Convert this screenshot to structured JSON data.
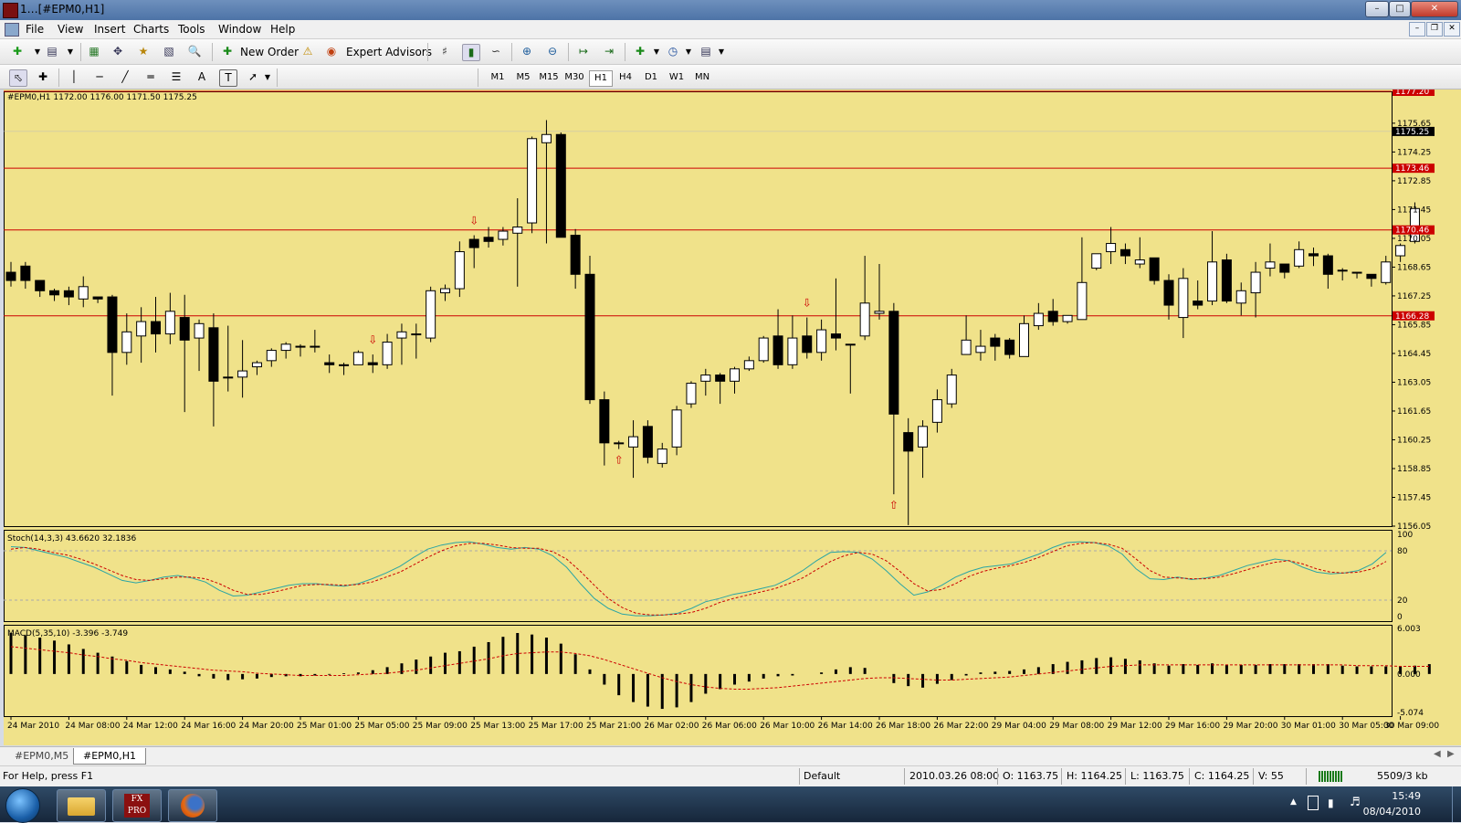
{
  "window": {
    "title": "1…[#EPM0,H1]",
    "btn_min": "–",
    "btn_max": "□",
    "btn_close": "✕"
  },
  "menu": {
    "items": [
      "File",
      "View",
      "Insert",
      "Charts",
      "Tools",
      "Window",
      "Help"
    ]
  },
  "toolbar": {
    "new_order": "New Order",
    "expert_advisors": "Expert Advisors"
  },
  "timeframes": {
    "items": [
      "M1",
      "M5",
      "M15",
      "M30",
      "H1",
      "H4",
      "D1",
      "W1",
      "MN"
    ],
    "active": "H1"
  },
  "chart_info": "#EPM0,H1  1172.00 1176.00 1171.50 1175.25",
  "stoch_label": "Stoch(14,3,3) 43.6620 32.1836",
  "macd_label": "MACD(5,35,10) -3.396 -3.749",
  "tabs": [
    "#EPM0,M5",
    "#EPM0,H1"
  ],
  "status": {
    "help": "For Help, press F1",
    "profile": "Default",
    "datetime": "2010.03.26 08:00",
    "open": "O: 1163.75",
    "high": "H: 1164.25",
    "low": "L: 1163.75",
    "close": "C: 1164.25",
    "volume": "V: 55",
    "traffic": "5509/3 kb"
  },
  "taskbar": {
    "time": "15:49",
    "date": "08/04/2010"
  },
  "colors": {
    "chart_bg": "#f0e28a",
    "level_line": "#cc0000",
    "stoch_main": "#2aa5a5",
    "stoch_signal": "#cc0000",
    "macd_signal": "#cc0000",
    "price_tag": "#000000",
    "level_tag": "#cc0000"
  },
  "chart_data": [
    {
      "type": "candlestick",
      "symbol": "#EPM0,H1",
      "ylim": [
        1156.05,
        1177.2
      ],
      "y_ticks": [
        1156.05,
        1157.45,
        1158.85,
        1160.25,
        1161.65,
        1163.05,
        1164.45,
        1165.85,
        1167.25,
        1168.65,
        1170.05,
        1171.45,
        1172.85,
        1174.25,
        1175.65
      ],
      "price_tag": 1175.25,
      "levels": [
        1177.2,
        1173.46,
        1170.46,
        1166.28
      ],
      "x_labels": [
        "24 Mar 2010",
        "24 Mar 08:00",
        "24 Mar 12:00",
        "24 Mar 16:00",
        "24 Mar 20:00",
        "25 Mar 01:00",
        "25 Mar 05:00",
        "25 Mar 09:00",
        "25 Mar 13:00",
        "25 Mar 17:00",
        "25 Mar 21:00",
        "26 Mar 02:00",
        "26 Mar 06:00",
        "26 Mar 10:00",
        "26 Mar 14:00",
        "26 Mar 18:00",
        "26 Mar 22:00",
        "29 Mar 04:00",
        "29 Mar 08:00",
        "29 Mar 12:00",
        "29 Mar 16:00",
        "29 Mar 20:00",
        "30 Mar 01:00",
        "30 Mar 05:00",
        "30 Mar 09:00"
      ],
      "fractal_up_markers": [
        25,
        32,
        55
      ],
      "fractal_down_markers": [
        42,
        61
      ],
      "ohlc": [
        [
          1168.4,
          1168.9,
          1167.7,
          1168.0
        ],
        [
          1168.7,
          1168.9,
          1167.6,
          1168.0
        ],
        [
          1168.0,
          1168.0,
          1167.2,
          1167.5
        ],
        [
          1167.5,
          1167.6,
          1167.0,
          1167.3
        ],
        [
          1167.5,
          1167.7,
          1166.8,
          1167.2
        ],
        [
          1167.1,
          1168.2,
          1166.7,
          1167.7
        ],
        [
          1167.2,
          1167.2,
          1166.9,
          1167.1
        ],
        [
          1167.2,
          1167.3,
          1162.4,
          1164.5
        ],
        [
          1164.5,
          1166.4,
          1163.9,
          1165.5
        ],
        [
          1165.3,
          1166.7,
          1164.0,
          1166.0
        ],
        [
          1166.0,
          1167.2,
          1164.5,
          1165.4
        ],
        [
          1165.4,
          1167.4,
          1164.9,
          1166.5
        ],
        [
          1166.2,
          1167.3,
          1161.6,
          1165.1
        ],
        [
          1165.2,
          1166.1,
          1163.6,
          1165.9
        ],
        [
          1165.7,
          1166.4,
          1160.9,
          1163.1
        ],
        [
          1163.3,
          1165.8,
          1162.6,
          1163.3
        ],
        [
          1163.3,
          1165.1,
          1162.3,
          1163.6
        ],
        [
          1163.8,
          1164.1,
          1163.4,
          1164.0
        ],
        [
          1164.1,
          1164.7,
          1163.8,
          1164.6
        ],
        [
          1164.6,
          1165.0,
          1164.2,
          1164.9
        ],
        [
          1164.8,
          1164.9,
          1164.3,
          1164.8
        ],
        [
          1164.8,
          1165.6,
          1164.5,
          1164.8
        ],
        [
          1164.0,
          1164.4,
          1163.5,
          1163.9
        ],
        [
          1163.9,
          1164.0,
          1163.4,
          1163.9
        ],
        [
          1163.9,
          1164.6,
          1163.9,
          1164.5
        ],
        [
          1164.0,
          1164.4,
          1163.5,
          1163.9
        ],
        [
          1163.9,
          1165.4,
          1163.7,
          1165.0
        ],
        [
          1165.2,
          1165.9,
          1163.9,
          1165.5
        ],
        [
          1165.4,
          1165.9,
          1164.2,
          1165.4
        ],
        [
          1165.2,
          1167.7,
          1165.0,
          1167.5
        ],
        [
          1167.4,
          1167.8,
          1167.0,
          1167.6
        ],
        [
          1167.6,
          1169.9,
          1167.2,
          1169.4
        ],
        [
          1170.0,
          1170.2,
          1168.6,
          1169.6
        ],
        [
          1170.1,
          1170.6,
          1169.6,
          1169.9
        ],
        [
          1170.0,
          1170.6,
          1169.7,
          1170.4
        ],
        [
          1170.3,
          1172.0,
          1167.7,
          1170.6
        ],
        [
          1170.8,
          1175.0,
          1170.3,
          1174.9
        ],
        [
          1174.7,
          1175.8,
          1169.8,
          1175.1
        ],
        [
          1175.1,
          1175.2,
          1170.1,
          1170.1
        ],
        [
          1170.2,
          1170.5,
          1167.6,
          1168.3
        ],
        [
          1168.3,
          1169.2,
          1162.0,
          1162.2
        ],
        [
          1162.2,
          1162.6,
          1159.0,
          1160.1
        ],
        [
          1160.1,
          1160.2,
          1159.8,
          1160.1
        ],
        [
          1159.9,
          1161.2,
          1158.4,
          1160.4
        ],
        [
          1160.9,
          1161.2,
          1159.1,
          1159.4
        ],
        [
          1159.1,
          1160.1,
          1158.9,
          1159.8
        ],
        [
          1159.9,
          1161.9,
          1159.5,
          1161.7
        ],
        [
          1162.0,
          1163.1,
          1161.8,
          1163.0
        ],
        [
          1163.1,
          1163.7,
          1162.4,
          1163.4
        ],
        [
          1163.4,
          1163.5,
          1162.0,
          1163.1
        ],
        [
          1163.1,
          1163.8,
          1162.5,
          1163.7
        ],
        [
          1163.7,
          1164.3,
          1163.6,
          1164.1
        ],
        [
          1164.1,
          1165.3,
          1164.0,
          1165.2
        ],
        [
          1165.3,
          1166.6,
          1163.7,
          1163.9
        ],
        [
          1163.9,
          1166.3,
          1163.7,
          1165.2
        ],
        [
          1165.3,
          1166.2,
          1164.2,
          1164.5
        ],
        [
          1164.5,
          1166.1,
          1164.1,
          1165.6
        ],
        [
          1165.4,
          1168.1,
          1164.6,
          1165.2
        ],
        [
          1164.9,
          1164.9,
          1162.5,
          1164.9
        ],
        [
          1165.3,
          1169.2,
          1165.1,
          1166.9
        ],
        [
          1166.4,
          1168.8,
          1166.1,
          1166.5
        ],
        [
          1166.5,
          1166.9,
          1157.6,
          1161.5
        ],
        [
          1160.6,
          1161.3,
          1156.1,
          1159.7
        ],
        [
          1159.9,
          1161.2,
          1158.4,
          1160.9
        ],
        [
          1161.1,
          1162.7,
          1160.6,
          1162.2
        ],
        [
          1162.0,
          1163.7,
          1161.8,
          1163.4
        ],
        [
          1164.4,
          1166.3,
          1164.4,
          1165.1
        ],
        [
          1164.5,
          1165.6,
          1164.1,
          1164.8
        ],
        [
          1165.2,
          1165.4,
          1164.1,
          1164.8
        ],
        [
          1165.1,
          1165.2,
          1164.2,
          1164.4
        ],
        [
          1164.3,
          1166.3,
          1164.3,
          1165.9
        ],
        [
          1165.8,
          1166.9,
          1165.6,
          1166.4
        ],
        [
          1166.5,
          1167.1,
          1165.8,
          1166.0
        ],
        [
          1166.0,
          1166.3,
          1165.9,
          1166.3
        ],
        [
          1166.1,
          1170.1,
          1166.1,
          1167.9
        ],
        [
          1168.6,
          1169.3,
          1168.5,
          1169.3
        ],
        [
          1169.4,
          1170.6,
          1168.8,
          1169.8
        ],
        [
          1169.5,
          1169.8,
          1168.8,
          1169.2
        ],
        [
          1168.8,
          1170.1,
          1168.6,
          1169.0
        ],
        [
          1169.1,
          1169.1,
          1167.8,
          1168.0
        ],
        [
          1168.0,
          1168.3,
          1166.1,
          1166.8
        ],
        [
          1166.2,
          1168.6,
          1165.2,
          1168.1
        ],
        [
          1167.0,
          1168.0,
          1166.6,
          1166.8
        ],
        [
          1167.0,
          1170.4,
          1166.8,
          1168.9
        ],
        [
          1169.0,
          1169.3,
          1166.9,
          1167.0
        ],
        [
          1166.9,
          1167.9,
          1166.3,
          1167.5
        ],
        [
          1167.4,
          1168.9,
          1166.2,
          1168.4
        ],
        [
          1168.6,
          1169.8,
          1168.2,
          1168.9
        ],
        [
          1168.8,
          1168.8,
          1168.1,
          1168.4
        ],
        [
          1168.7,
          1169.9,
          1168.6,
          1169.5
        ],
        [
          1169.3,
          1169.6,
          1168.7,
          1169.2
        ],
        [
          1169.2,
          1169.3,
          1167.6,
          1168.3
        ],
        [
          1168.5,
          1168.6,
          1168.0,
          1168.5
        ],
        [
          1168.4,
          1168.4,
          1168.1,
          1168.4
        ],
        [
          1168.3,
          1168.3,
          1167.7,
          1168.1
        ],
        [
          1167.9,
          1169.2,
          1167.8,
          1168.9
        ],
        [
          1169.2,
          1169.8,
          1168.9,
          1169.7
        ],
        [
          1169.9,
          1171.8,
          1169.8,
          1171.5
        ]
      ]
    },
    {
      "type": "line",
      "name": "Stoch(14,3,3)",
      "ylim": [
        0,
        100
      ],
      "y_ticks": [
        0,
        20,
        80,
        100
      ],
      "series": [
        {
          "role": "main",
          "values": [
            85,
            84,
            80,
            76,
            72,
            66,
            60,
            52,
            44,
            41,
            44,
            48,
            50,
            47,
            42,
            32,
            25,
            26,
            30,
            34,
            38,
            40,
            40,
            38,
            37,
            40,
            46,
            53,
            61,
            72,
            82,
            87,
            90,
            91,
            88,
            84,
            82,
            84,
            82,
            74,
            60,
            40,
            22,
            10,
            3,
            1,
            1,
            2,
            4,
            10,
            18,
            22,
            27,
            30,
            34,
            38,
            46,
            56,
            68,
            78,
            79,
            78,
            70,
            56,
            40,
            26,
            30,
            38,
            48,
            55,
            60,
            62,
            64,
            70,
            76,
            84,
            90,
            91,
            90,
            86,
            76,
            58,
            46,
            45,
            48,
            45,
            47,
            50,
            56,
            62,
            66,
            70,
            68,
            60,
            54,
            52,
            53,
            56,
            64,
            78
          ]
        },
        {
          "role": "signal",
          "values": [
            82,
            84,
            82,
            78,
            75,
            70,
            64,
            57,
            50,
            45,
            44,
            46,
            48,
            48,
            46,
            40,
            32,
            27,
            27,
            30,
            34,
            38,
            39,
            39,
            38,
            39,
            42,
            48,
            54,
            63,
            72,
            80,
            86,
            89,
            89,
            87,
            84,
            83,
            83,
            79,
            70,
            55,
            38,
            22,
            11,
            4,
            2,
            2,
            3,
            5,
            10,
            17,
            22,
            26,
            30,
            34,
            40,
            47,
            57,
            67,
            74,
            78,
            76,
            68,
            55,
            40,
            31,
            33,
            40,
            49,
            55,
            59,
            62,
            66,
            72,
            79,
            86,
            89,
            90,
            88,
            83,
            70,
            56,
            48,
            47,
            46,
            46,
            48,
            52,
            57,
            62,
            66,
            68,
            64,
            58,
            54,
            53,
            54,
            58,
            67
          ]
        }
      ]
    },
    {
      "type": "bar",
      "name": "MACD(5,35,10)",
      "ylim": [
        -5.074,
        6.003
      ],
      "y_ticks": [
        -5.074,
        0.0,
        6.003
      ],
      "histogram": [
        5.4,
        5.1,
        4.8,
        4.4,
        3.9,
        3.3,
        2.8,
        2.3,
        1.7,
        1.2,
        0.9,
        0.6,
        0.3,
        -0.3,
        -0.6,
        -0.8,
        -0.7,
        -0.6,
        -0.4,
        -0.3,
        -0.3,
        -0.2,
        -0.1,
        0.1,
        0.2,
        0.5,
        0.9,
        1.4,
        1.9,
        2.3,
        2.8,
        3.0,
        3.6,
        4.2,
        4.9,
        5.4,
        5.2,
        4.8,
        4.0,
        2.6,
        0.6,
        -1.4,
        -2.8,
        -3.7,
        -4.3,
        -4.6,
        -4.4,
        -3.7,
        -2.6,
        -2.0,
        -1.4,
        -1.0,
        -0.6,
        -0.3,
        -0.2,
        0.0,
        0.2,
        0.6,
        0.9,
        0.8,
        0.0,
        -1.2,
        -1.6,
        -1.8,
        -1.3,
        -0.8,
        -0.2,
        0.2,
        0.3,
        0.4,
        0.6,
        0.9,
        1.3,
        1.6,
        1.8,
        2.1,
        2.2,
        2.0,
        1.8,
        1.4,
        1.1,
        1.3,
        1.2,
        1.4,
        1.2,
        1.2,
        1.2,
        1.3,
        1.3,
        1.3,
        1.3,
        1.3,
        1.1,
        1.0,
        1.0,
        1.0,
        1.0,
        1.1,
        1.3
      ],
      "signal": [
        3.6,
        3.4,
        3.2,
        3.0,
        2.8,
        2.5,
        2.3,
        2.0,
        1.8,
        1.5,
        1.3,
        1.1,
        0.9,
        0.7,
        0.5,
        0.4,
        0.3,
        0.1,
        0.0,
        -0.1,
        -0.2,
        -0.2,
        -0.2,
        -0.2,
        -0.1,
        0.0,
        0.1,
        0.3,
        0.5,
        0.8,
        1.1,
        1.4,
        1.7,
        2.0,
        2.4,
        2.7,
        2.8,
        2.9,
        2.9,
        2.7,
        2.4,
        1.9,
        1.3,
        0.7,
        0.1,
        -0.5,
        -1.0,
        -1.4,
        -1.7,
        -1.9,
        -2.0,
        -2.0,
        -1.9,
        -1.8,
        -1.6,
        -1.4,
        -1.2,
        -1.0,
        -0.8,
        -0.6,
        -0.5,
        -0.5,
        -0.6,
        -0.7,
        -0.8,
        -0.8,
        -0.7,
        -0.6,
        -0.5,
        -0.4,
        -0.2,
        0.0,
        0.2,
        0.4,
        0.6,
        0.8,
        1.0,
        1.1,
        1.2,
        1.2,
        1.2,
        1.2,
        1.2,
        1.2,
        1.2,
        1.2,
        1.2,
        1.2,
        1.2,
        1.2,
        1.2,
        1.2,
        1.2,
        1.1,
        1.1,
        1.1,
        1.0,
        1.0,
        1.0
      ]
    }
  ]
}
